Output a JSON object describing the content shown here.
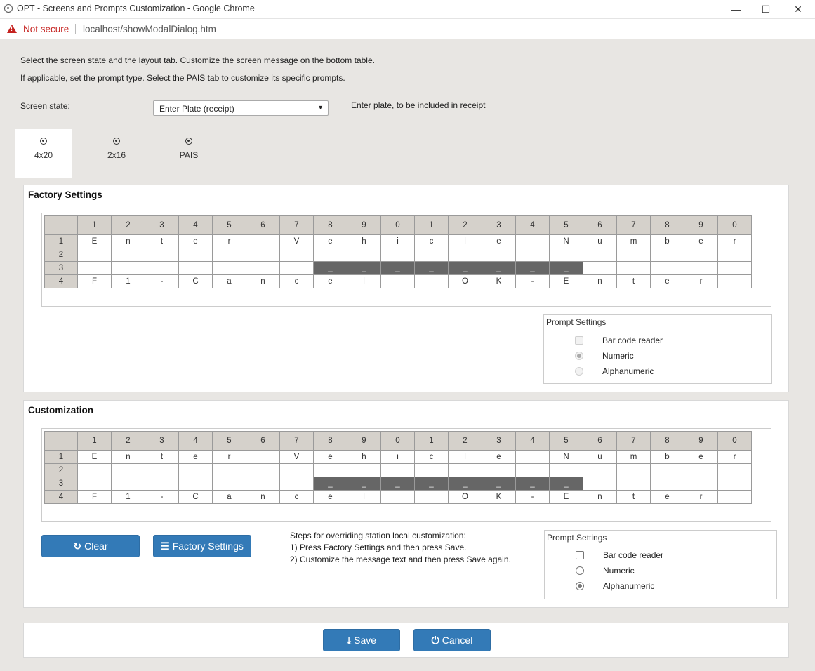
{
  "window": {
    "title": "OPT - Screens and Prompts Customization - Google Chrome",
    "minimize": "—",
    "maximize": "☐",
    "close": "✕"
  },
  "address": {
    "security": "Not secure",
    "url": "localhost/showModalDialog.htm"
  },
  "intro": {
    "line1": "Select the screen state and the layout tab. Customize the screen message on the bottom table.",
    "line2": "If applicable, set the prompt type. Select the PAIS tab to customize its specific prompts."
  },
  "screen_state": {
    "label": "Screen state:",
    "selected": "Enter Plate (receipt)",
    "description": "Enter plate, to be included in receipt"
  },
  "tabs": [
    {
      "label": "4x20",
      "active": true
    },
    {
      "label": "2x16",
      "active": false
    },
    {
      "label": "PAIS",
      "active": false
    }
  ],
  "factory": {
    "title": "Factory Settings",
    "prompt": {
      "title": "Prompt Settings",
      "options": [
        "Bar code reader",
        "Numeric",
        "Alphanumeric"
      ]
    }
  },
  "customization": {
    "title": "Customization",
    "prompt": {
      "title": "Prompt Settings",
      "options": [
        "Bar code reader",
        "Numeric",
        "Alphanumeric"
      ]
    }
  },
  "grid": {
    "columns": [
      "1",
      "2",
      "3",
      "4",
      "5",
      "6",
      "7",
      "8",
      "9",
      "0",
      "1",
      "2",
      "3",
      "4",
      "5",
      "6",
      "7",
      "8",
      "9",
      "0"
    ],
    "rows": [
      {
        "label": "1",
        "cells": [
          "E",
          "n",
          "t",
          "e",
          "r",
          "",
          "V",
          "e",
          "h",
          "i",
          "c",
          "l",
          "e",
          "",
          "N",
          "u",
          "m",
          "b",
          "e",
          "r"
        ]
      },
      {
        "label": "2",
        "cells": [
          "",
          "",
          "",
          "",
          "",
          "",
          "",
          "",
          "",
          "",
          "",
          "",
          "",
          "",
          "",
          "",
          "",
          "",
          "",
          ""
        ]
      },
      {
        "label": "3",
        "cells": [
          "",
          "",
          "",
          "",
          "",
          "",
          "",
          "_",
          "_",
          "_",
          "_",
          "_",
          "_",
          "_",
          "_",
          "",
          "",
          "",
          "",
          ""
        ]
      },
      {
        "label": "4",
        "cells": [
          "F",
          "1",
          "-",
          "C",
          "a",
          "n",
          "c",
          "e",
          "l",
          "",
          "",
          "O",
          "K",
          "-",
          "E",
          "n",
          "t",
          "e",
          "r",
          ""
        ]
      }
    ]
  },
  "buttons": {
    "clear": "Clear",
    "factory_settings": "Factory Settings",
    "save": "Save",
    "cancel": "Cancel"
  },
  "steps": {
    "line1": "Steps for overriding station local customization:",
    "line2": "1) Press Factory Settings and then press Save.",
    "line3": "2) Customize the message text and then press Save again."
  },
  "colors": {
    "primary": "#337ab7",
    "header_cell": "#d5d1cb",
    "dark_cell": "#666666",
    "warning": "#c5221f"
  }
}
